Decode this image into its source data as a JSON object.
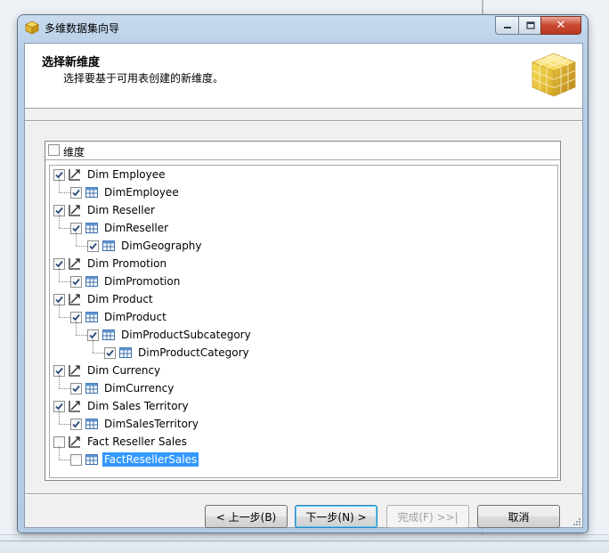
{
  "window": {
    "title": "多维数据集向导"
  },
  "header": {
    "title": "选择新维度",
    "subtitle": "选择要基于可用表创建的新维度。"
  },
  "tree": {
    "column_header": "维度",
    "items": [
      {
        "label": "Dim Employee",
        "type": "dimension",
        "level": 0,
        "checked": true
      },
      {
        "label": "DimEmployee",
        "type": "table",
        "level": 1,
        "checked": true
      },
      {
        "label": "Dim Reseller",
        "type": "dimension",
        "level": 0,
        "checked": true
      },
      {
        "label": "DimReseller",
        "type": "table",
        "level": 1,
        "checked": true
      },
      {
        "label": "DimGeography",
        "type": "table",
        "level": 2,
        "checked": true
      },
      {
        "label": "Dim Promotion",
        "type": "dimension",
        "level": 0,
        "checked": true
      },
      {
        "label": "DimPromotion",
        "type": "table",
        "level": 1,
        "checked": true
      },
      {
        "label": "Dim Product",
        "type": "dimension",
        "level": 0,
        "checked": true
      },
      {
        "label": "DimProduct",
        "type": "table",
        "level": 1,
        "checked": true
      },
      {
        "label": "DimProductSubcategory",
        "type": "table",
        "level": 2,
        "checked": true
      },
      {
        "label": "DimProductCategory",
        "type": "table",
        "level": 3,
        "checked": true
      },
      {
        "label": "Dim Currency",
        "type": "dimension",
        "level": 0,
        "checked": true
      },
      {
        "label": "DimCurrency",
        "type": "table",
        "level": 1,
        "checked": true
      },
      {
        "label": "Dim Sales Territory",
        "type": "dimension",
        "level": 0,
        "checked": true
      },
      {
        "label": "DimSalesTerritory",
        "type": "table",
        "level": 1,
        "checked": true
      },
      {
        "label": "Fact Reseller Sales",
        "type": "dimension",
        "level": 0,
        "checked": false
      },
      {
        "label": "FactResellerSales",
        "type": "table",
        "level": 1,
        "checked": false,
        "selected": true
      }
    ]
  },
  "buttons": {
    "back": "< 上一步(B)",
    "next": "下一步(N) >",
    "finish": "完成(F) >>|",
    "cancel": "取消"
  },
  "titlebar_buttons": {
    "close": "✕"
  },
  "colors": {
    "selection": "#3399ff",
    "title_gradient_top": "#c9dbee",
    "close_red": "#c9472f"
  }
}
